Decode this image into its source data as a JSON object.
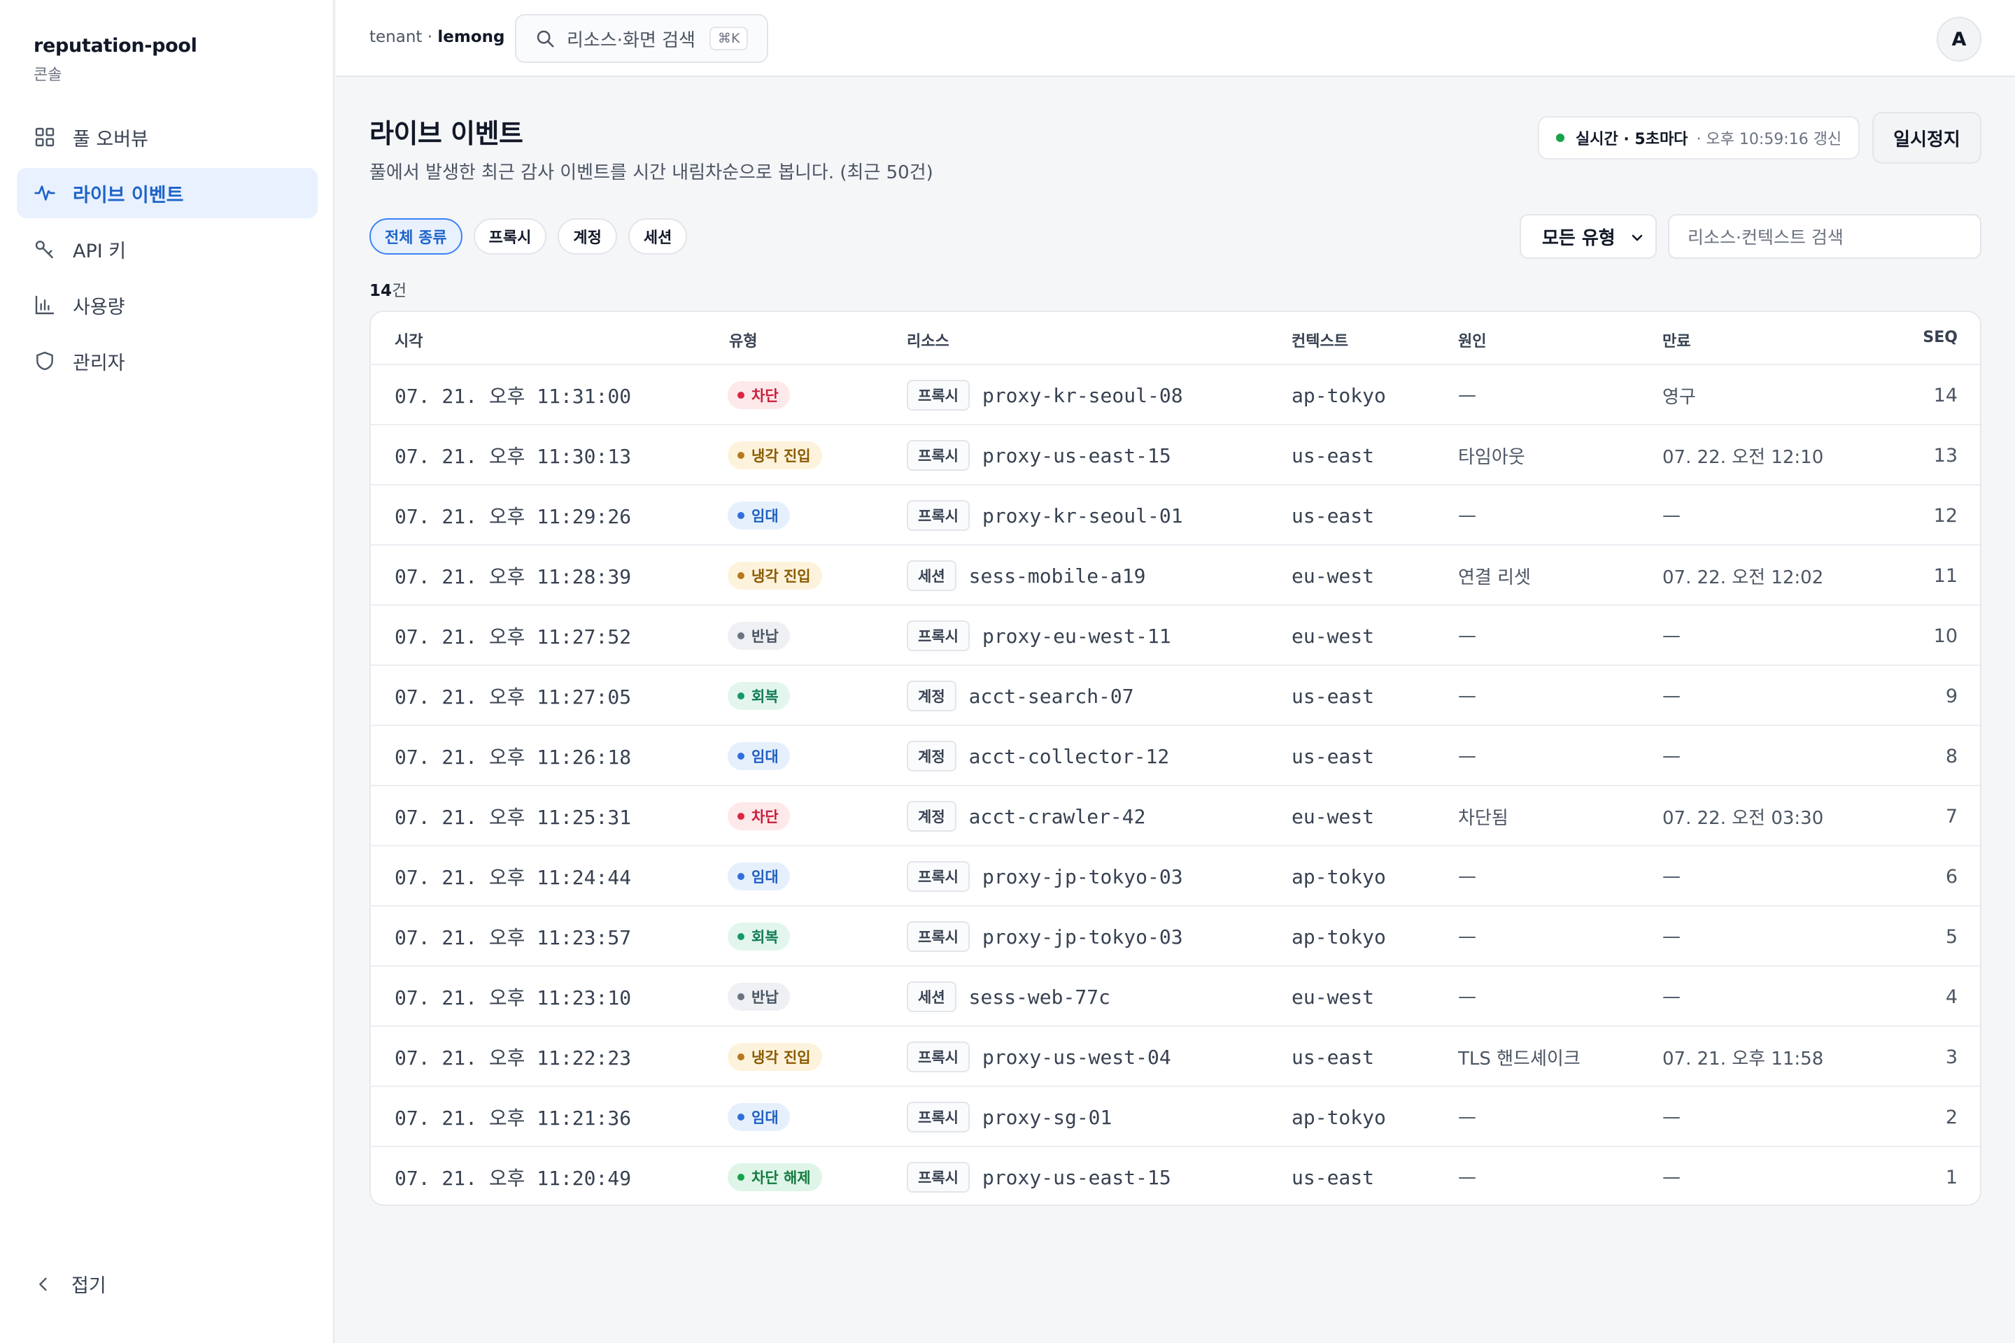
{
  "sidebar": {
    "brand": "reputation-pool",
    "brand_sub": "콘솔",
    "items": [
      {
        "label": "풀 오버뷰",
        "icon": "grid-icon"
      },
      {
        "label": "라이브 이벤트",
        "icon": "activity-icon"
      },
      {
        "label": "API 키",
        "icon": "key-icon"
      },
      {
        "label": "사용량",
        "icon": "bar-chart-icon"
      },
      {
        "label": "관리자",
        "icon": "shield-icon"
      }
    ],
    "collapse_label": "접기"
  },
  "topbar": {
    "tenant_prefix": "tenant · ",
    "tenant_name": "lemong",
    "search_placeholder": "리소스·화면 검색",
    "search_shortcut": "⌘K",
    "avatar": "A"
  },
  "page": {
    "title": "라이브 이벤트",
    "description": "풀에서 발생한 최근 감사 이벤트를 시간 내림차순으로 봅니다. (최근 50건)",
    "live_label": "실시간 · 5초마다",
    "live_refresh": "· 오후 10:59:16 갱신",
    "pause_label": "일시정지"
  },
  "filters": {
    "chips": [
      "전체 종류",
      "프록시",
      "계정",
      "세션"
    ],
    "type_select": "모든 유형",
    "search_placeholder": "리소스·컨텍스트 검색",
    "count_number": "14",
    "count_unit": "건"
  },
  "table": {
    "headers": [
      "시각",
      "유형",
      "리소스",
      "컨텍스트",
      "원인",
      "만료",
      "SEQ"
    ],
    "rows": [
      {
        "time": "07. 21. 오후 11:31:00",
        "type": "차단",
        "kind": "프록시",
        "resource": "proxy-kr-seoul-08",
        "context": "ap-tokyo",
        "cause": "—",
        "expires": "영구",
        "seq": "14"
      },
      {
        "time": "07. 21. 오후 11:30:13",
        "type": "냉각 진입",
        "kind": "프록시",
        "resource": "proxy-us-east-15",
        "context": "us-east",
        "cause": "타임아웃",
        "expires": "07. 22. 오전 12:10",
        "seq": "13"
      },
      {
        "time": "07. 21. 오후 11:29:26",
        "type": "임대",
        "kind": "프록시",
        "resource": "proxy-kr-seoul-01",
        "context": "us-east",
        "cause": "—",
        "expires": "—",
        "seq": "12"
      },
      {
        "time": "07. 21. 오후 11:28:39",
        "type": "냉각 진입",
        "kind": "세션",
        "resource": "sess-mobile-a19",
        "context": "eu-west",
        "cause": "연결 리셋",
        "expires": "07. 22. 오전 12:02",
        "seq": "11"
      },
      {
        "time": "07. 21. 오후 11:27:52",
        "type": "반납",
        "kind": "프록시",
        "resource": "proxy-eu-west-11",
        "context": "eu-west",
        "cause": "—",
        "expires": "—",
        "seq": "10"
      },
      {
        "time": "07. 21. 오후 11:27:05",
        "type": "회복",
        "kind": "계정",
        "resource": "acct-search-07",
        "context": "us-east",
        "cause": "—",
        "expires": "—",
        "seq": "9"
      },
      {
        "time": "07. 21. 오후 11:26:18",
        "type": "임대",
        "kind": "계정",
        "resource": "acct-collector-12",
        "context": "us-east",
        "cause": "—",
        "expires": "—",
        "seq": "8"
      },
      {
        "time": "07. 21. 오후 11:25:31",
        "type": "차단",
        "kind": "계정",
        "resource": "acct-crawler-42",
        "context": "eu-west",
        "cause": "차단됨",
        "expires": "07. 22. 오전 03:30",
        "seq": "7"
      },
      {
        "time": "07. 21. 오후 11:24:44",
        "type": "임대",
        "kind": "프록시",
        "resource": "proxy-jp-tokyo-03",
        "context": "ap-tokyo",
        "cause": "—",
        "expires": "—",
        "seq": "6"
      },
      {
        "time": "07. 21. 오후 11:23:57",
        "type": "회복",
        "kind": "프록시",
        "resource": "proxy-jp-tokyo-03",
        "context": "ap-tokyo",
        "cause": "—",
        "expires": "—",
        "seq": "5"
      },
      {
        "time": "07. 21. 오후 11:23:10",
        "type": "반납",
        "kind": "세션",
        "resource": "sess-web-77c",
        "context": "eu-west",
        "cause": "—",
        "expires": "—",
        "seq": "4"
      },
      {
        "time": "07. 21. 오후 11:22:23",
        "type": "냉각 진입",
        "kind": "프록시",
        "resource": "proxy-us-west-04",
        "context": "us-east",
        "cause": "TLS 핸드셰이크",
        "expires": "07. 21. 오후 11:58",
        "seq": "3"
      },
      {
        "time": "07. 21. 오후 11:21:36",
        "type": "임대",
        "kind": "프록시",
        "resource": "proxy-sg-01",
        "context": "ap-tokyo",
        "cause": "—",
        "expires": "—",
        "seq": "2"
      },
      {
        "time": "07. 21. 오후 11:20:49",
        "type": "차단 해제",
        "kind": "프록시",
        "resource": "proxy-us-east-15",
        "context": "us-east",
        "cause": "—",
        "expires": "—",
        "seq": "1"
      }
    ]
  },
  "badge_colors": {
    "차단": {
      "bg": "#fde8ea",
      "fg": "#c81e3a",
      "dot": "#dc2642"
    },
    "냉각 진입": {
      "bg": "#fdf3dc",
      "fg": "#8a5a00",
      "dot": "#b7791f"
    },
    "임대": {
      "bg": "#e6f0fd",
      "fg": "#1e5fc2",
      "dot": "#2f6fdb"
    },
    "반납": {
      "bg": "#eef0f3",
      "fg": "#4b5563",
      "dot": "#6b7280"
    },
    "회복": {
      "bg": "#e3f6ee",
      "fg": "#0f7a55",
      "dot": "#14996a"
    },
    "차단 해제": {
      "bg": "#def5e8",
      "fg": "#137a3f",
      "dot": "#16a34a"
    }
  }
}
